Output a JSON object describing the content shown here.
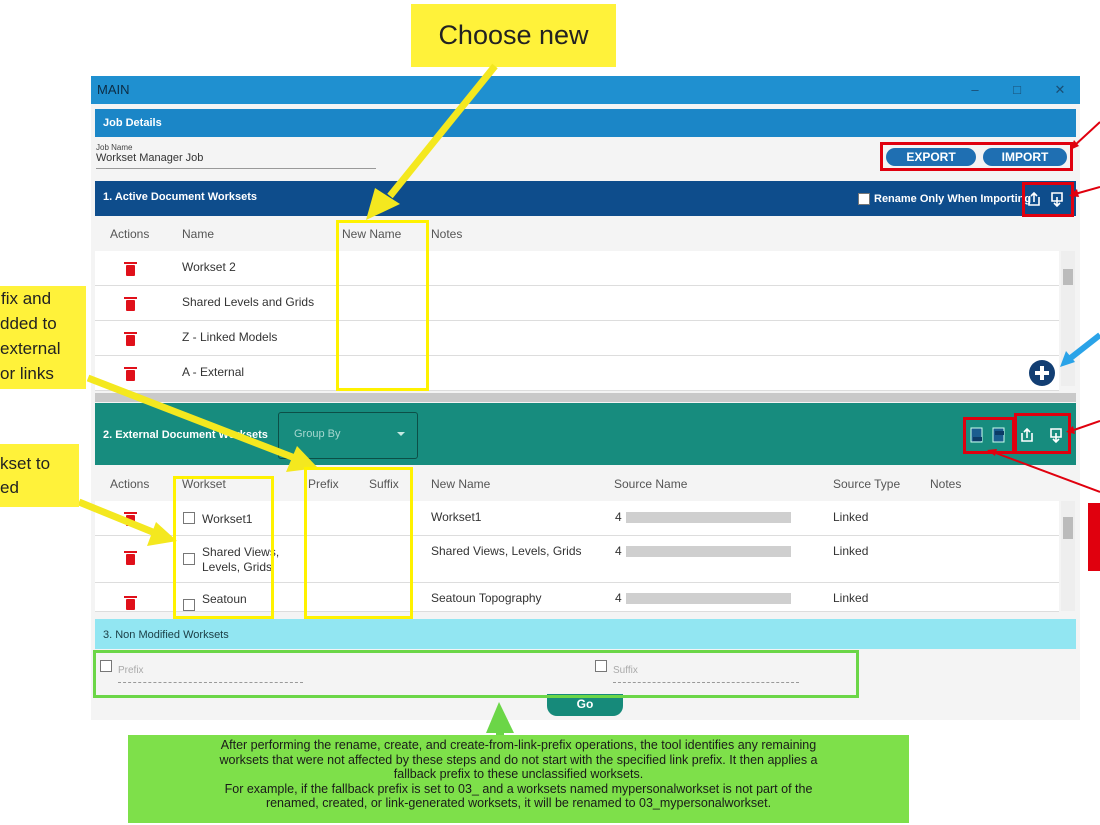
{
  "window": {
    "title": "MAIN",
    "controls": {
      "minimize": "–",
      "maximize": "□",
      "close": "✕"
    }
  },
  "job_details": {
    "header": "Job Details",
    "job_name_label": "Job Name",
    "job_name_value": "Workset Manager Job",
    "export_label": "EXPORT",
    "import_label": "IMPORT"
  },
  "active_section": {
    "title": "1. Active Document Worksets",
    "rename_only_label": "Rename Only When Importing",
    "columns": [
      "Actions",
      "Name",
      "New Name",
      "Notes"
    ],
    "rows": [
      {
        "name": "Workset 2",
        "new_name": "",
        "notes": ""
      },
      {
        "name": "Shared Levels and Grids",
        "new_name": "",
        "notes": ""
      },
      {
        "name": "Z - Linked Models",
        "new_name": "",
        "notes": ""
      },
      {
        "name": "A - External",
        "new_name": "",
        "notes": ""
      }
    ],
    "add_icon": "plus-circle-icon"
  },
  "external_section": {
    "title": "2. External Document Worksets",
    "group_by_placeholder": "Group By",
    "columns": [
      "Actions",
      "Workset",
      "Prefix",
      "Suffix",
      "New Name",
      "Source Name",
      "Source Type",
      "Notes"
    ],
    "rows": [
      {
        "workset": "Workset1",
        "new_name": "Workset1",
        "source_name": "4",
        "source_type": "Linked"
      },
      {
        "workset": "Shared Views, Levels, Grids",
        "new_name": "Shared Views, Levels, Grids",
        "source_name": "4",
        "source_type": "Linked"
      },
      {
        "workset": "Seatoun",
        "new_name": "Seatoun Topography",
        "source_name": "4",
        "source_type": "Linked"
      }
    ]
  },
  "non_modified": {
    "title": "3. Non Modified Worksets",
    "prefix_placeholder": "Prefix",
    "suffix_placeholder": "Suffix",
    "go_label": "Go"
  },
  "annotations": {
    "choose_new": "Choose new",
    "left_note_1": [
      "fix and",
      "dded to",
      "external",
      "or links"
    ],
    "left_note_2": [
      "kset to",
      "ed"
    ],
    "bottom_note": [
      "After performing the rename, create, and create-from-link-prefix operations, the tool identifies any remaining",
      "worksets that were not affected by these steps and do not start with the specified link prefix. It then applies a",
      "fallback prefix to these unclassified worksets.",
      "For example, if the fallback prefix is set to 03_ and a worksets named mypersonalworkset is not part of the",
      "renamed, created, or link-generated worksets, it will be renamed to 03_mypersonalworkset."
    ],
    "colors": {
      "yellow": "#fff23a",
      "red": "#e0000e",
      "green": "#6bd647",
      "blue": "#2aa3e8"
    }
  }
}
